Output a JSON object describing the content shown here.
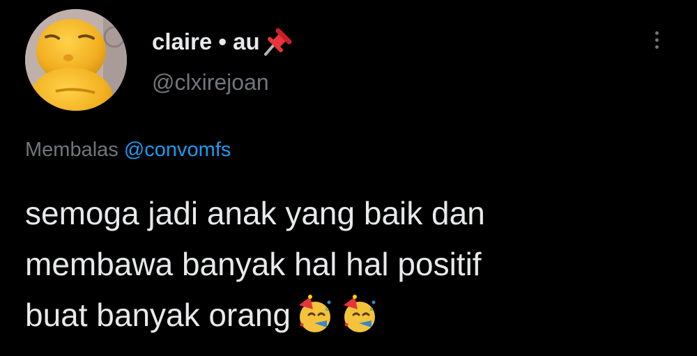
{
  "user": {
    "display_name": "claire • au",
    "handle": "@clxirejoan",
    "avatar_icon": "yellow-blob-avatar"
  },
  "menu": {
    "more_icon": "vertical-ellipsis-icon"
  },
  "reply": {
    "prefix": "Membalas",
    "mention": "@convomfs"
  },
  "tweet": {
    "lines": [
      "semoga jadi anak yang baik dan",
      "membawa banyak hal hal positif",
      "buat banyak orang"
    ],
    "trailing_emoji": [
      "party-face-emoji",
      "party-face-emoji"
    ],
    "name_emoji": "pushpin-icon"
  },
  "colors": {
    "background": "#000000",
    "primary_text": "#e7e9ea",
    "secondary_text": "#71767b",
    "link": "#1d9bf0"
  }
}
